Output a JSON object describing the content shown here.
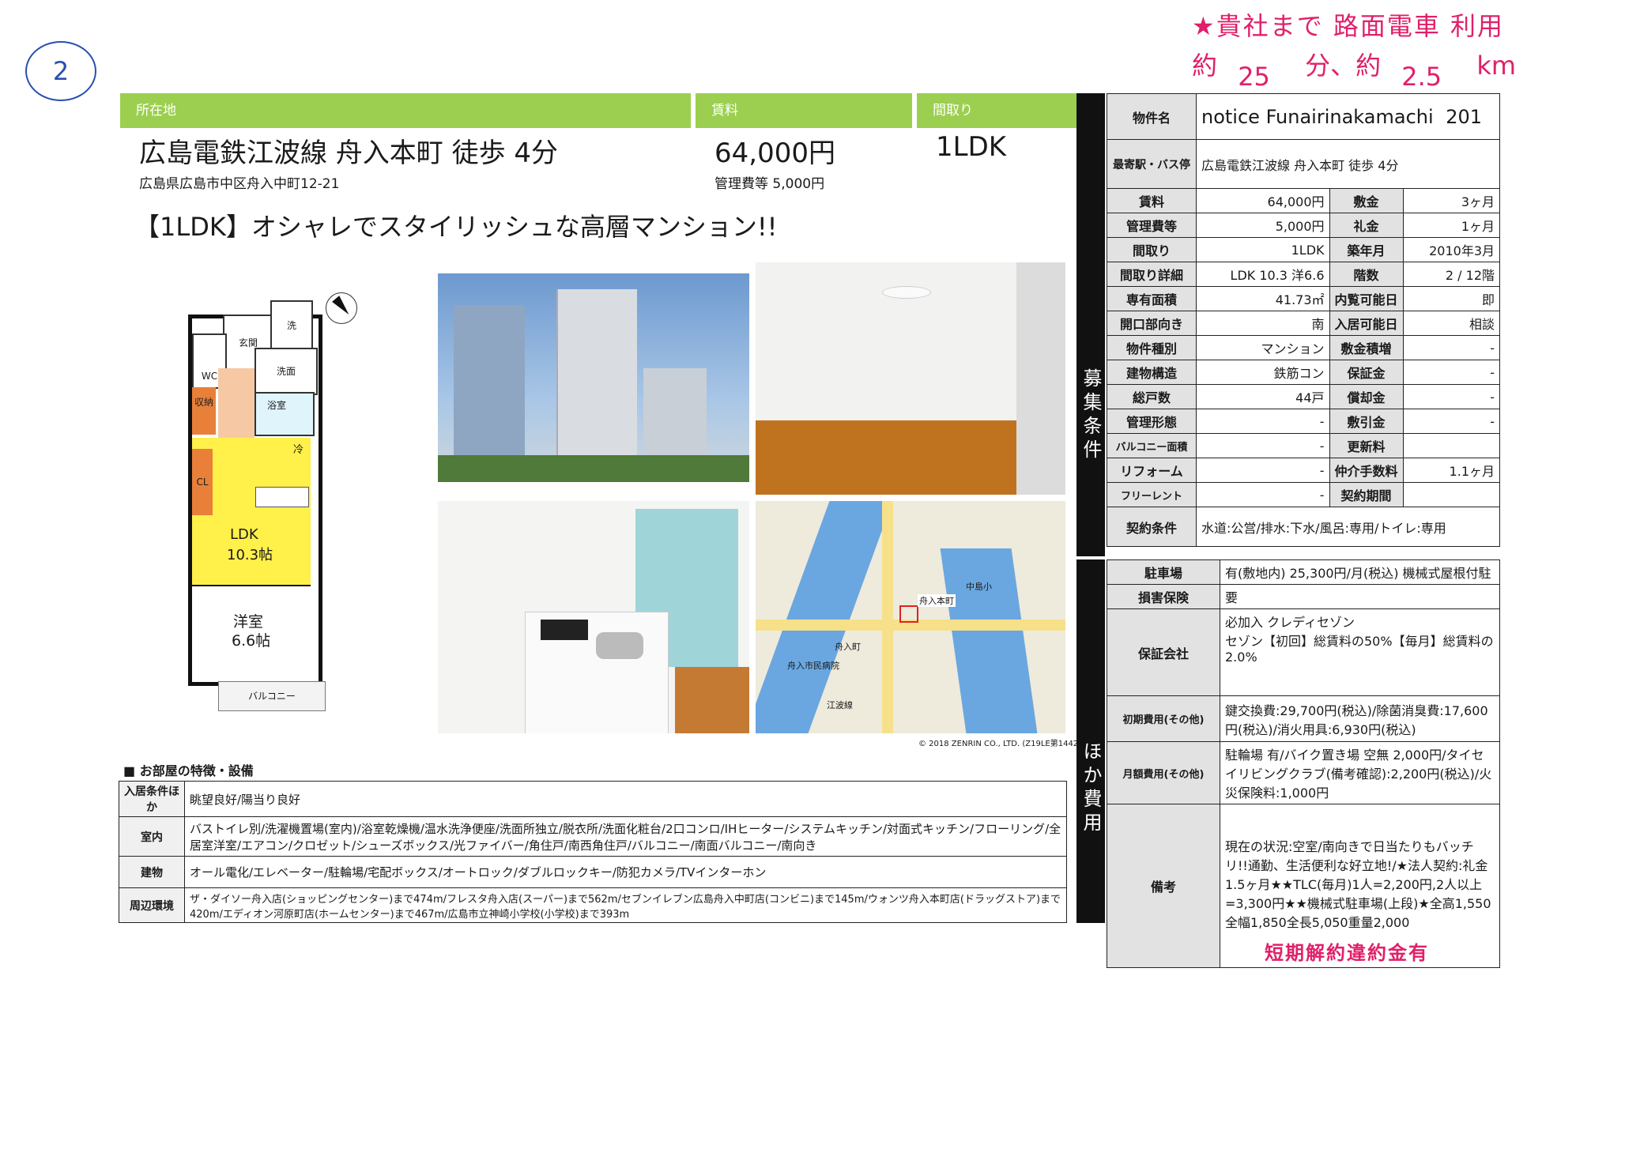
{
  "page_number": "2",
  "handwritten": {
    "line1": "★貴社まで 路面電車 利用",
    "line2_prefix": "約",
    "minutes": "25",
    "line2_mid": "分、約",
    "distance": "2.5",
    "unit": "km"
  },
  "header": {
    "location_label": "所在地",
    "location_main": "広島電鉄江波線 舟入本町 徒歩 4分",
    "address": "広島県広島市中区舟入中町12-21",
    "rent_label": "賃料",
    "rent_value": "64,000円",
    "mgmt_fee": "管理費等 5,000円",
    "layout_label": "間取り",
    "layout_value": "1LDK"
  },
  "headline": "【1LDK】オシャレでスタイリッシュな高層マンション!!",
  "floorplan": {
    "genkan": "玄関",
    "sentaku": "洗",
    "senmen": "洗面",
    "wc": "WC",
    "shuno": "収納",
    "yokushitsu": "浴室",
    "rei": "冷",
    "cl": "CL",
    "ldk": "LDK",
    "ldk_size": "10.3帖",
    "yoshitsu": "洋室",
    "yoshitsu_size": "6.6帖",
    "balcony": "バルコニー"
  },
  "map": {
    "copyright": "© 2018 ZENRIN CO., LTD. (Z19LE第1442号)",
    "labels": [
      "舟入本町",
      "中島小",
      "舟入町",
      "舟入市民病院",
      "江波線"
    ]
  },
  "features": {
    "title": "■ お部屋の特徴・設備",
    "rows": [
      {
        "key": "入居条件ほか",
        "value": "眺望良好/陽当り良好"
      },
      {
        "key": "室内",
        "value": "バストイレ別/洗濯機置場(室内)/浴室乾燥機/温水洗浄便座/洗面所独立/脱衣所/洗面化粧台/2口コンロ/IHヒーター/システムキッチン/対面式キッチン/フローリング/全居室洋室/エアコン/クロゼット/シューズボックス/光ファイバー/角住戸/南西角住戸/バルコニー/南面バルコニー/南向き"
      },
      {
        "key": "建物",
        "value": "オール電化/エレベーター/駐輪場/宅配ボックス/オートロック/ダブルロックキー/防犯カメラ/TVインターホン"
      },
      {
        "key": "周辺環境",
        "value": "ザ・ダイソー舟入店(ショッピングセンター)まで474m/フレスタ舟入店(スーパー)まで562m/セブンイレブン広島舟入中町店(コンビニ)まで145m/ウォンツ舟入本町店(ドラッグストア)まで420m/エディオン河原町店(ホームセンター)まで467m/広島市立神崎小学校(小学校)まで393m"
      }
    ]
  },
  "side": {
    "boshu_label": "募集条件",
    "hoka_label": "ほか費用",
    "property_name_label": "物件名",
    "property_name": "notice Funairinakamachi",
    "room_no": "201",
    "station_label": "最寄駅・バス停",
    "station_value": "広島電鉄江波線 舟入本町 徒歩 4分",
    "spec_rows": [
      [
        "賃料",
        "64,000円",
        "敷金",
        "3ヶ月"
      ],
      [
        "管理費等",
        "5,000円",
        "礼金",
        "1ヶ月"
      ],
      [
        "間取り",
        "1LDK",
        "築年月",
        "2010年3月"
      ],
      [
        "間取り詳細",
        "LDK 10.3 洋6.6",
        "階数",
        "2 / 12階"
      ],
      [
        "専有面積",
        "41.73㎡",
        "内覧可能日",
        "即"
      ],
      [
        "開口部向き",
        "南",
        "入居可能日",
        "相談"
      ],
      [
        "物件種別",
        "マンション",
        "敷金積増",
        "-"
      ],
      [
        "建物構造",
        "鉄筋コン",
        "保証金",
        "-"
      ],
      [
        "総戸数",
        "44戸",
        "償却金",
        "-"
      ],
      [
        "管理形態",
        "-",
        "敷引金",
        "-"
      ],
      [
        "バルコニー面積",
        "-",
        "更新料",
        ""
      ],
      [
        "リフォーム",
        "-",
        "仲介手数料",
        "1.1ヶ月"
      ],
      [
        "フリーレント",
        "-",
        "契約期間",
        ""
      ]
    ],
    "contract_label": "契約条件",
    "contract_value": "水道:公営/排水:下水/風呂:専用/トイレ:専用",
    "cost_rows": [
      {
        "key": "駐車場",
        "value": "有(敷地内) 25,300円/月(税込) 機械式屋根付駐"
      },
      {
        "key": "損害保険",
        "value": "要"
      },
      {
        "key": "保証会社",
        "value": "必加入 クレディセゾン\nセゾン【初回】総賃料の50%【毎月】総賃料の2.0%"
      },
      {
        "key": "初期費用(その他)",
        "value": "鍵交換費:29,700円(税込)/除菌消臭費:17,600円(税込)/消火用具:6,930円(税込)"
      },
      {
        "key": "月額費用(その他)",
        "value": "駐輪場 有/バイク置き場 空無 2,000円/タイセイリビングクラブ(備考確認):2,200円(税込)/火災保険料:1,000円"
      },
      {
        "key": "備考",
        "value": "現在の状況:空室/南向きで日当たりもバッチリ!!通勤、生活便利な好立地!/★法人契約:礼金1.5ヶ月★★TLC(毎月)1人=2,200円,2人以上=3,300円★★機械式駐車場(上段)★全高1,550全幅1,850全長5,050重量2,000"
      }
    ],
    "stamp": "短期解約違約金有"
  }
}
